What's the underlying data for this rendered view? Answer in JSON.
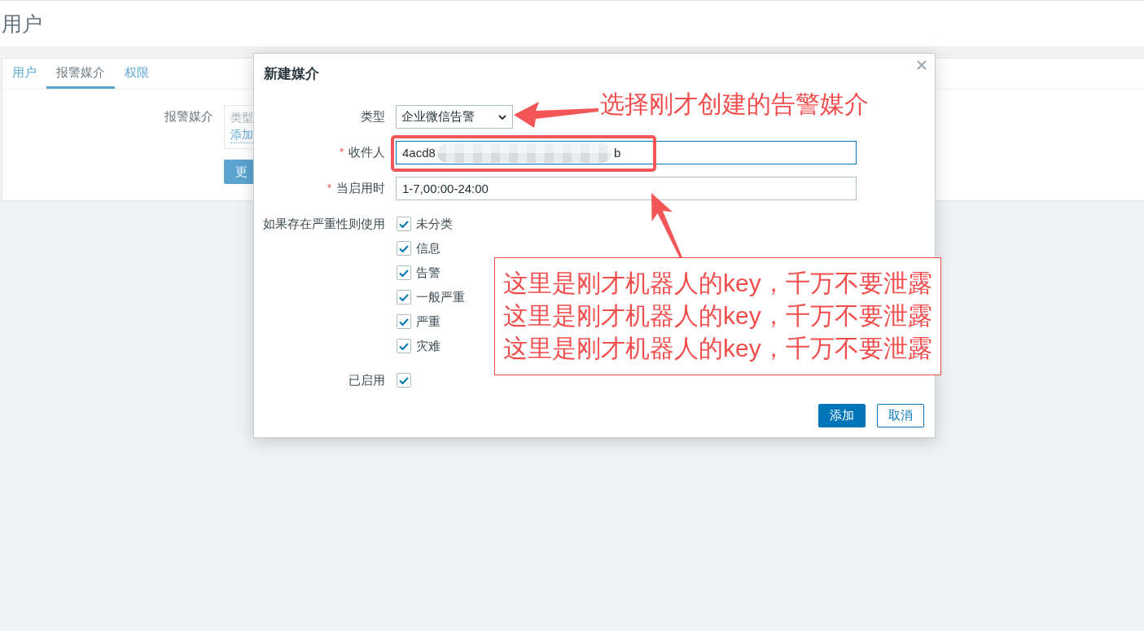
{
  "page": {
    "title": "用户"
  },
  "tabs": [
    {
      "label": "用户",
      "selected": false
    },
    {
      "label": "报警媒介",
      "selected": true
    },
    {
      "label": "权限",
      "selected": false
    }
  ],
  "media_form": {
    "label": "报警媒介",
    "table_header": "类型",
    "add_link": "添加",
    "update_button": "更"
  },
  "dialog": {
    "title": "新建媒介",
    "fields": [
      {
        "kind": "select",
        "label": "类型",
        "value": "企业微信告警"
      },
      {
        "kind": "text",
        "label": "收件人",
        "required_mark": "*",
        "value_parts": [
          "4acd8",
          "b"
        ],
        "focused": true
      },
      {
        "kind": "text",
        "label": "当启用时",
        "required_mark": "*",
        "value_parts": [
          "1-7,00:00-24:00"
        ],
        "focused": false
      },
      {
        "kind": "checklist",
        "label": "如果存在严重性则使用",
        "options": [
          {
            "label": "未分类",
            "checked": true
          },
          {
            "label": "信息",
            "checked": true
          },
          {
            "label": "告警",
            "checked": true
          },
          {
            "label": "一般严重",
            "checked": true
          },
          {
            "label": "严重",
            "checked": true
          },
          {
            "label": "灾难",
            "checked": true
          }
        ]
      },
      {
        "kind": "checkbox",
        "label": "已启用",
        "checked": true
      }
    ],
    "buttons": [
      {
        "label": "添加",
        "primary": true
      },
      {
        "label": "取消",
        "primary": false
      }
    ]
  },
  "annotations": {
    "select_hint": "选择刚才创建的告警媒介",
    "key_note": [
      "这里是刚才机器人的key，千万不要泄露",
      "这里是刚才机器人的key，千万不要泄露",
      "这里是刚才机器人的key，千万不要泄露"
    ]
  }
}
